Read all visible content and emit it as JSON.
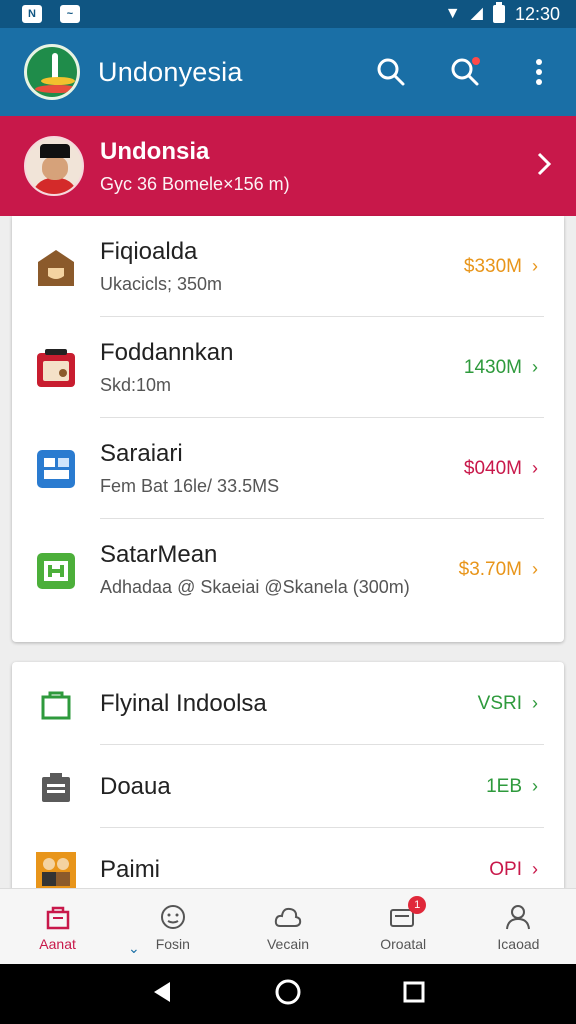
{
  "status_bar": {
    "time": "12:30"
  },
  "app_bar": {
    "title": "Undonyesia"
  },
  "banner": {
    "name": "Undonsia",
    "subtitle": "Gyc 36 Bomele×156 m)"
  },
  "list1": [
    {
      "title": "Fiqioalda",
      "subtitle": "Ukacicls; 350m",
      "value": "$330M",
      "color": "#e8951a",
      "icon": "home-icon"
    },
    {
      "title": "Foddannkan",
      "subtitle": "Skd:10m",
      "value": "1430M",
      "color": "#2e9a3c",
      "icon": "radio-icon"
    },
    {
      "title": "Saraiari",
      "subtitle": "Fem Bat 16le/ 33.5MS",
      "value": "$040M",
      "color": "#c8184a",
      "icon": "grid-icon"
    },
    {
      "title": "SatarMean",
      "subtitle": "Adhadaa @ Skaeiai @Skanela (300m)",
      "value": "$3.70M",
      "color": "#e8951a",
      "icon": "hospital-icon"
    }
  ],
  "list2": [
    {
      "title": "Flyinal Indoolsa",
      "value": "VSRI",
      "color": "#2e9a3c",
      "icon": "bag-icon"
    },
    {
      "title": "Doaua",
      "value": "1EB",
      "color": "#2e9a3c",
      "icon": "clipboard-icon"
    },
    {
      "title": "Paimi",
      "value": "OPI",
      "color": "#c8184a",
      "icon": "people-icon"
    }
  ],
  "bottom_nav": [
    {
      "label": "Aanat",
      "icon": "bag-icon",
      "active": true
    },
    {
      "label": "Fosin",
      "icon": "face-icon"
    },
    {
      "label": "Vecain",
      "icon": "cloud-icon"
    },
    {
      "label": "Oroatal",
      "icon": "chat-icon",
      "badge": "1"
    },
    {
      "label": "Icaoad",
      "icon": "person-icon"
    }
  ],
  "colors": {
    "primary": "#1a6fa6",
    "banner": "#c8184a",
    "status": "#0f5582"
  }
}
